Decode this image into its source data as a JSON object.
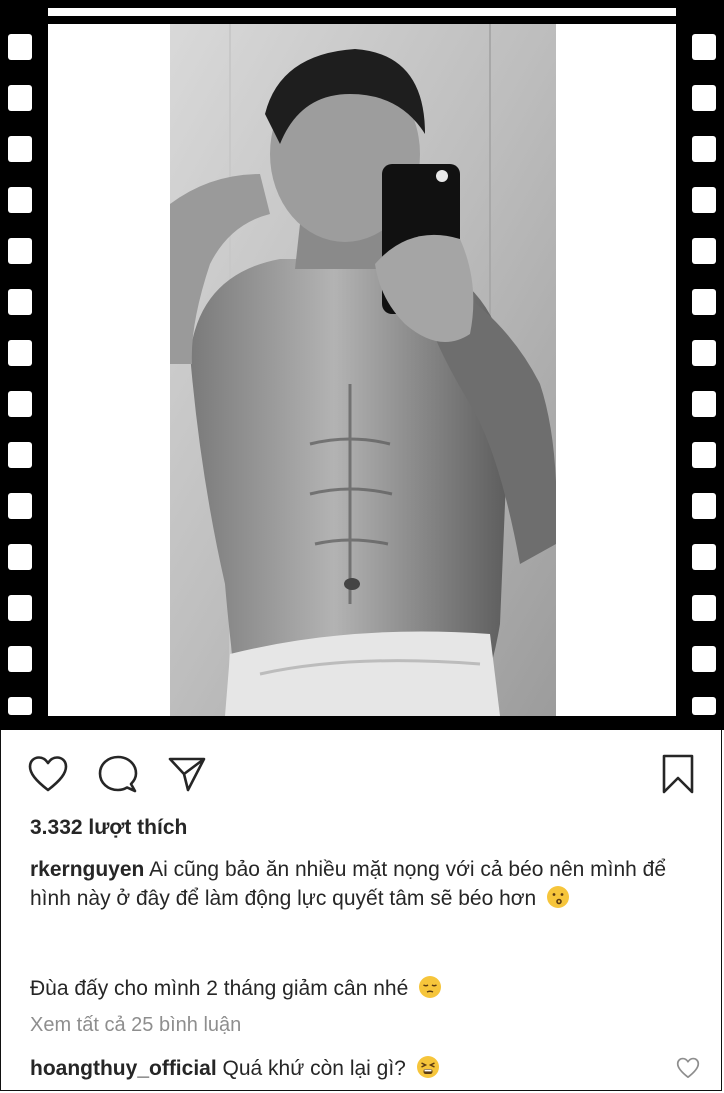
{
  "photo": {
    "description_icon": "photo-image"
  },
  "actions": {
    "like_icon": "heart-icon",
    "comment_icon": "comment-icon",
    "share_icon": "share-icon",
    "save_icon": "bookmark-icon"
  },
  "post": {
    "likes": "3.332 lượt thích",
    "author": "rkernguyen",
    "caption_line1": "Ai cũng bảo ăn nhiều mặt nọng với cả béo nên mình để hình này ở đây để làm động lực quyết tâm sẽ béo hơn",
    "caption_emoji1": "kissing-face-emoji",
    "caption_line2": "Đùa đấy cho mình 2 tháng giảm cân nhé",
    "caption_emoji2": "pensive-face-emoji",
    "view_all_comments": "Xem tất cả 25 bình luận"
  },
  "comment": {
    "username": "hoangthuy_official",
    "text": "Quá khứ còn lại gì?",
    "emoji": "tired-face-emoji"
  },
  "colors": {
    "text": "#262626",
    "muted": "#8e8e8e",
    "film": "#000000",
    "emoji": "#f6c53b"
  }
}
